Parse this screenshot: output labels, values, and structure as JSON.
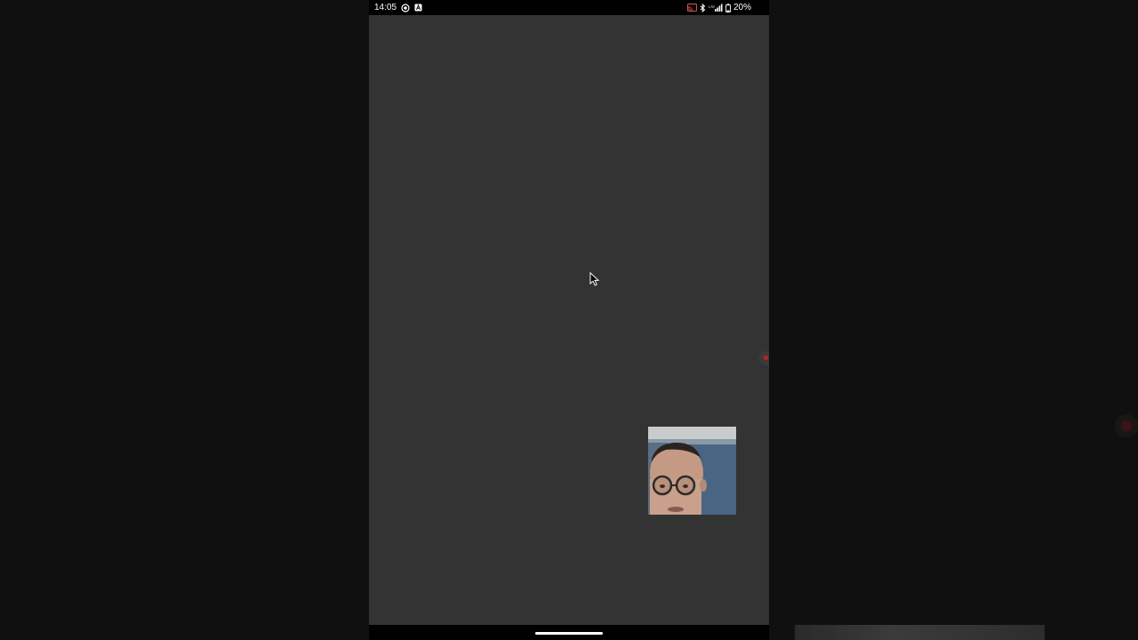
{
  "status_bar": {
    "time": "14:05",
    "left_icons": [
      "screen-record-icon",
      "notification-a-icon"
    ],
    "right_icons": [
      "cast-icon",
      "bluetooth-icon",
      "signal-icon",
      "battery-icon"
    ],
    "battery_percent": "20%"
  },
  "recording_indicator_color": "#c02020",
  "nav_bar": {
    "home_indicator": "home-pill"
  }
}
